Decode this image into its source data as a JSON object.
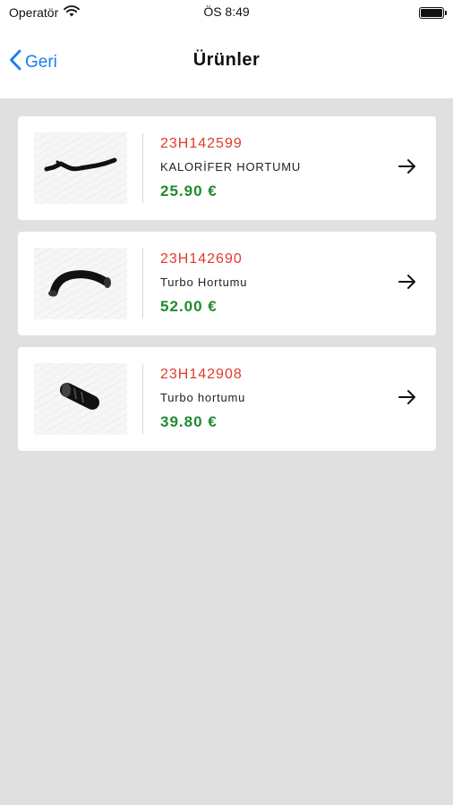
{
  "status_bar": {
    "carrier": "Operatör",
    "time": "ÖS 8:49",
    "icons": [
      "wifi-icon",
      "battery-icon"
    ]
  },
  "nav": {
    "back_label": "Geri",
    "title": "Ürünler"
  },
  "products": [
    {
      "code": "23H142599",
      "name": "KALORİFER HORTUMU",
      "price": "25.90 €",
      "image": "hose-long-icon"
    },
    {
      "code": "23H142690",
      "name": "Turbo Hortumu",
      "price": "52.00 €",
      "image": "hose-curved-icon"
    },
    {
      "code": "23H142908",
      "name": "Turbo hortumu",
      "price": "39.80 €",
      "image": "hose-short-icon"
    }
  ],
  "colors": {
    "accent": "#1a7cf5",
    "code": "#e0392b",
    "price": "#1f8a2e",
    "background": "#e0e0e0"
  }
}
